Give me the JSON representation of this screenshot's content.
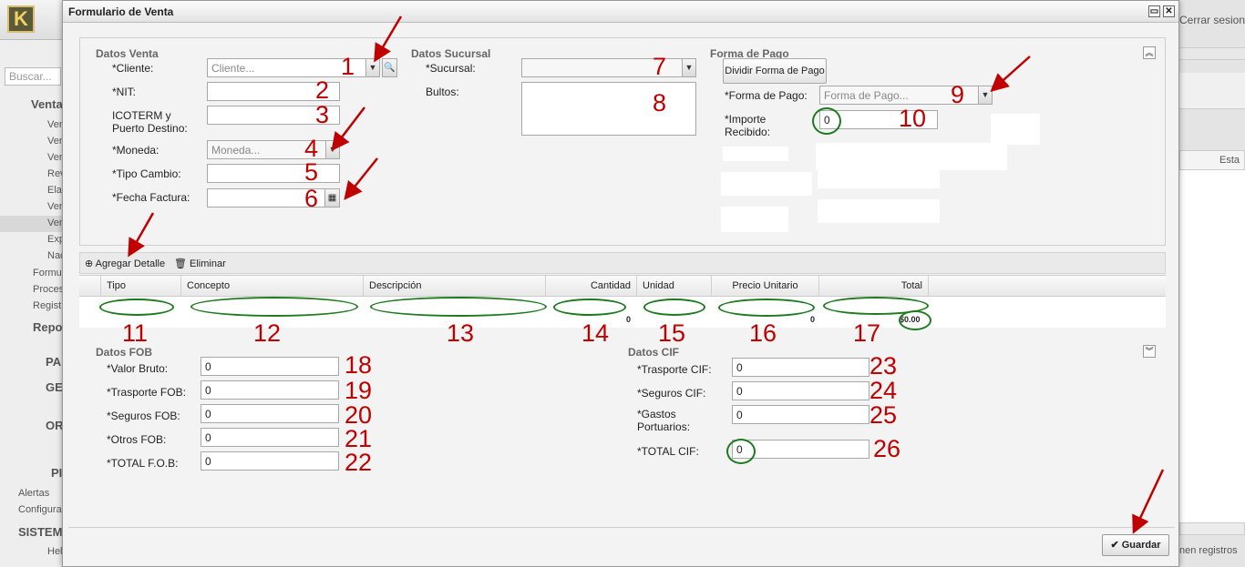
{
  "background_app": {
    "logo": "K",
    "search_placeholder": "Buscar...",
    "logout": "Cerrar sesion",
    "status_col": "Esta",
    "footer_right": "nen registros",
    "sidebar": [
      "Venta",
      "Ven",
      "Ven",
      "Ven",
      "Rev",
      "Ela",
      "Ven",
      "Ven",
      "Exp",
      "Nac",
      "Formu",
      "Proces",
      "Regist",
      "Repo",
      "PA",
      "GE",
      "OR",
      "PI",
      "Alertas",
      "Configura",
      "SISTEM",
      "Hel"
    ]
  },
  "modal": {
    "title": "Formulario de Venta",
    "datos_venta": {
      "section": "Datos Venta",
      "cliente_label": "*Cliente:",
      "cliente_placeholder": "Cliente...",
      "nit_label": "*NIT:",
      "icoterm_label": "ICOTERM y Puerto Destino:",
      "moneda_label": "*Moneda:",
      "moneda_placeholder": "Moneda...",
      "tipo_cambio_label": "*Tipo Cambio:",
      "fecha_label": "*Fecha Factura:"
    },
    "datos_sucursal": {
      "section": "Datos Sucursal",
      "sucursal_label": "*Sucursal:",
      "bultos_label": "Bultos:"
    },
    "forma_pago": {
      "section": "Forma de Pago",
      "dividir_button": "Dividir Forma de Pago",
      "forma_label": "*Forma de Pago:",
      "forma_placeholder": "Forma de Pago...",
      "importe_label": "*Importe Recibido:",
      "importe_value": "0"
    },
    "toolbar": {
      "add": "Agregar Detalle",
      "delete": "Eliminar"
    },
    "grid": {
      "columns": [
        "Tipo",
        "Concepto",
        "Descripción",
        "Cantidad",
        "Unidad",
        "Precio Unitario",
        "Total"
      ],
      "cantidad_value": "0",
      "precio_value": "0",
      "total_value": "$0.00"
    },
    "datos_fob": {
      "section": "Datos FOB",
      "fields": [
        {
          "label": "*Valor Bruto:",
          "value": "0"
        },
        {
          "label": "*Trasporte FOB:",
          "value": "0"
        },
        {
          "label": "*Seguros FOB:",
          "value": "0"
        },
        {
          "label": "*Otros FOB:",
          "value": "0"
        },
        {
          "label": "*TOTAL F.O.B:",
          "value": "0"
        }
      ]
    },
    "datos_cif": {
      "section": "Datos CIF",
      "fields": [
        {
          "label": "*Trasporte CIF:",
          "value": "0"
        },
        {
          "label": "*Seguros CIF:",
          "value": "0"
        },
        {
          "label": "*Gastos Portuarios:",
          "value": "0"
        },
        {
          "label": "*TOTAL CIF:",
          "value": "0"
        }
      ]
    },
    "guardar_button": "Guardar"
  },
  "annotations": [
    "1",
    "2",
    "3",
    "4",
    "5",
    "6",
    "7",
    "8",
    "9",
    "10",
    "11",
    "12",
    "13",
    "14",
    "15",
    "16",
    "17",
    "18",
    "19",
    "20",
    "21",
    "22",
    "23",
    "24",
    "25",
    "26"
  ]
}
